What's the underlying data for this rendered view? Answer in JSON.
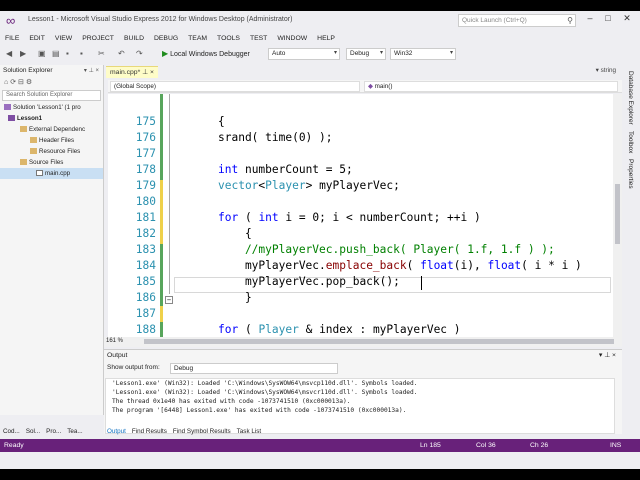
{
  "window": {
    "title": "Lesson1 - Microsoft Visual Studio Express 2012 for Windows Desktop (Administrator)",
    "quick_launch_placeholder": "Quick Launch (Ctrl+Q)",
    "controls": [
      "–",
      "□",
      "✕"
    ]
  },
  "menu": [
    "FILE",
    "EDIT",
    "VIEW",
    "PROJECT",
    "BUILD",
    "DEBUG",
    "TEAM",
    "TOOLS",
    "TEST",
    "WINDOW",
    "HELP"
  ],
  "toolbar": {
    "run_label": "Local Windows Debugger",
    "run_mode": "Auto",
    "config": "Debug",
    "platform": "Win32"
  },
  "solution_explorer": {
    "title": "Solution Explorer",
    "search_placeholder": "Search Solution Explorer",
    "items": [
      {
        "label": "Solution 'Lesson1' (1 pro",
        "icon": "solution-icon"
      },
      {
        "label": "Lesson1",
        "icon": "project-icon"
      },
      {
        "label": "External Dependenc",
        "icon": "folder-icon"
      },
      {
        "label": "Header Files",
        "icon": "folder-icon"
      },
      {
        "label": "Resource Files",
        "icon": "folder-icon"
      },
      {
        "label": "Source Files",
        "icon": "folder-icon"
      },
      {
        "label": "main.cpp",
        "icon": "cpp-file-icon"
      }
    ]
  },
  "editor": {
    "tab_label": "main.cpp*",
    "right_combo": "string",
    "scope": "(Global Scope)",
    "function": "main()",
    "zoom": "161 %",
    "lines": [
      {
        "n": "175",
        "text": "{"
      },
      {
        "n": "176",
        "text": "srand( time(0) );"
      },
      {
        "n": "177",
        "text": ""
      },
      {
        "n": "178",
        "text": "int numberCount = 5;"
      },
      {
        "n": "179",
        "text": "vector<Player> myPlayerVec;"
      },
      {
        "n": "180",
        "text": ""
      },
      {
        "n": "181",
        "text": "for ( int i = 0; i < numberCount; ++i )"
      },
      {
        "n": "182",
        "text": "    {"
      },
      {
        "n": "183",
        "text": "    //myPlayerVec.push_back( Player( 1.f, 1.f ) );"
      },
      {
        "n": "184",
        "text": "    myPlayerVec.emplace_back( float(i), float( i * i )"
      },
      {
        "n": "185",
        "text": "    myPlayerVec.pop_back();"
      },
      {
        "n": "186",
        "text": "    }"
      },
      {
        "n": "187",
        "text": ""
      },
      {
        "n": "188",
        "text": "for ( Player & index : myPlayerVec )"
      }
    ]
  },
  "right_strip": [
    "Database Explorer",
    "Toolbox",
    "Properties"
  ],
  "output": {
    "title": "Output",
    "show_label": "Show output from:",
    "show_value": "Debug",
    "lines": [
      "'Lesson1.exe' (Win32): Loaded 'C:\\Windows\\SysWOW64\\msvcp110d.dll'. Symbols loaded.",
      "'Lesson1.exe' (Win32): Loaded 'C:\\Windows\\SysWOW64\\msvcr110d.dll'. Symbols loaded.",
      "The thread 0x1e40 has exited with code -1073741510 (0xc000013a).",
      "The program '[6448] Lesson1.exe' has exited with code -1073741510 (0xc000013a)."
    ]
  },
  "bottom_tabs_left": [
    "Cod...",
    "Sol...",
    "Pro...",
    "Tea..."
  ],
  "bottom_tabs_right": [
    "Output",
    "Find Results",
    "Find Symbol Results",
    "Task List"
  ],
  "status": {
    "state": "Ready",
    "ln": "Ln 185",
    "col": "Col 36",
    "ch": "Ch 26",
    "mode": "INS"
  }
}
